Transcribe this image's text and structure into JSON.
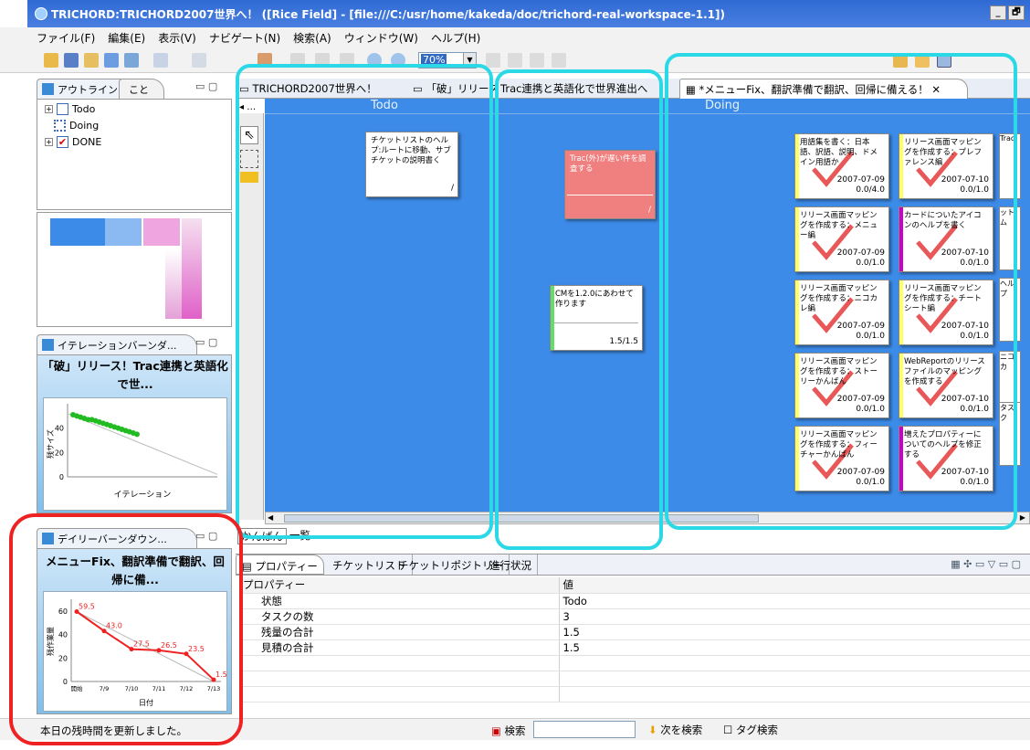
{
  "window": {
    "title": "TRICHORD:TRICHORD2007世界へ！ ([Rice Field] - [file:///C:/usr/home/kakeda/doc/trichord-real-workspace-1.1])",
    "controls": [
      "_",
      "🗗"
    ]
  },
  "menu": [
    "ファイル(F)",
    "編集(E)",
    "表示(V)",
    "ナビゲート(N)",
    "検索(A)",
    "ウィンドウ(W)",
    "ヘルプ(H)"
  ],
  "toolbar": {
    "zoom": "70%"
  },
  "outline": {
    "tabs": [
      "アウトライン",
      "こと"
    ],
    "items": [
      {
        "label": "Todo",
        "state": "unchecked"
      },
      {
        "label": "Doing",
        "state": "doing"
      },
      {
        "label": "DONE",
        "state": "checked"
      }
    ]
  },
  "iteration_burndown": {
    "tab": "イテレーションバーンダ...",
    "title": "「破」リリース！Trac連携と英語化で世...",
    "ylabel": "残サイズ",
    "xlabel": "イテレーション",
    "yticks": [
      "40",
      "20",
      "0"
    ]
  },
  "daily_burndown": {
    "tab": "デイリーバーンダウン...",
    "title": "メニューFix、翻訳準備で翻訳、回帰に備...",
    "ylabel": "残作業量",
    "xlabel": "日付"
  },
  "editor_tabs": [
    "TRICHORD2007世界へ！",
    "「破」リリース",
    "Trac連携と英語化で世界進出へ",
    "*メニューFix、翻訳準備で翻訳、回帰に備える！"
  ],
  "board": {
    "columns": [
      "Todo",
      "Doing"
    ],
    "todo_cards": [
      {
        "text": "チケットリストのヘルプ:ルートに移動、サブチケットの説明書く",
        "value": "/",
        "color": "#ffffff"
      },
      {
        "text": "Trac(外)が遅い件を調査する",
        "value": "/",
        "color": "#f08080"
      },
      {
        "text": "CMを1.2.0にあわせて作ります",
        "value": "1.5/1.5",
        "color": "#ffffff"
      }
    ],
    "doing_cards": [
      {
        "text": "用語集を書く：日本語、訳語、説明、ドメイン用語か",
        "date": "2007-07-09",
        "value": "0.0/4.0",
        "bar": "#ffff66"
      },
      {
        "text": "リリース画面マッピングを作成する：プレファレンス編",
        "date": "2007-07-10",
        "value": "0.0/1.0",
        "bar": "#ffff66"
      },
      {
        "text": "リリース画面マッピングを作成する：メニュー編",
        "date": "2007-07-09",
        "value": "0.0/1.0",
        "bar": "#ffff66"
      },
      {
        "text": "カードについたアイコンのヘルプを書く",
        "date": "2007-07-10",
        "value": "0.0/1.0",
        "bar": "#cc00cc"
      },
      {
        "text": "リリース画面マッピングを作成する：ニコカレ編",
        "date": "2007-07-09",
        "value": "0.0/1.0",
        "bar": "#ffff66"
      },
      {
        "text": "リリース画面マッピングを作成する：チートシート編",
        "date": "2007-07-10",
        "value": "0.0/1.0",
        "bar": "#ffff66"
      },
      {
        "text": "リリース画面マッピングを作成する：ストーリーかんばん",
        "date": "2007-07-09",
        "value": "0.0/1.0",
        "bar": "#ffff66"
      },
      {
        "text": "WebReportのリリースファイルのマッピングを作成する",
        "date": "2007-07-10",
        "value": "0.0/1.0",
        "bar": "#ffff66"
      },
      {
        "text": "リリース画面マッピングを作成する：フィーチャーかんばん",
        "date": "2007-07-09",
        "value": "0.0/1.0",
        "bar": "#ffff66"
      },
      {
        "text": "増えたプロパティーについてのヘルプを修正する",
        "date": "2007-07-10",
        "value": "0.0/1.0",
        "bar": "#cc00cc"
      }
    ],
    "right_edge_snippets": [
      "Trac(",
      "ットム",
      "ヘルプ",
      "ニコカ",
      "タスク"
    ]
  },
  "view_tabs": [
    "かんばん",
    "一覧"
  ],
  "bottom_tabs": [
    "プロパティー",
    "チケットリスト",
    "チケットリポジトリー",
    "進行状況"
  ],
  "properties": {
    "headers": [
      "プロパティー",
      "値"
    ],
    "rows": [
      {
        "name": "状態",
        "value": "Todo"
      },
      {
        "name": "タスクの数",
        "value": "3"
      },
      {
        "name": "残量の合計",
        "value": "1.5"
      },
      {
        "name": "見積の合計",
        "value": "1.5"
      }
    ]
  },
  "status": {
    "message": "本日の残時間を更新しました。",
    "search_label": "検索",
    "next_label": "次を検索",
    "tag_search_label": "タグ検索"
  },
  "chart_data": [
    {
      "type": "line",
      "title": "「破」リリース！Trac連携と英語化で世...",
      "xlabel": "イテレーション",
      "ylabel": "残サイズ",
      "ylim": [
        0,
        60
      ],
      "yticks": [
        0,
        20,
        40
      ],
      "series": [
        {
          "values": [
            51,
            50,
            49,
            48,
            47,
            47,
            46,
            45,
            44,
            43,
            42,
            41,
            40,
            39,
            38,
            37,
            36,
            35
          ]
        }
      ]
    },
    {
      "type": "line",
      "title": "メニューFix、翻訳準備で翻訳、回帰に備...",
      "xlabel": "日付",
      "ylabel": "残作業量",
      "categories": [
        "開始",
        "7/9",
        "7/10",
        "7/11",
        "7/12",
        "7/13"
      ],
      "ylim": [
        0,
        70
      ],
      "yticks": [
        0,
        20,
        40,
        60
      ],
      "series": [
        {
          "values": [
            59.5,
            43.0,
            27.5,
            26.5,
            23.5,
            1.5
          ],
          "color": "#ee2222"
        }
      ],
      "data_labels": [
        "59.5",
        "43.0",
        "27.5",
        "26.5",
        "23.5",
        "1.5"
      ]
    }
  ]
}
